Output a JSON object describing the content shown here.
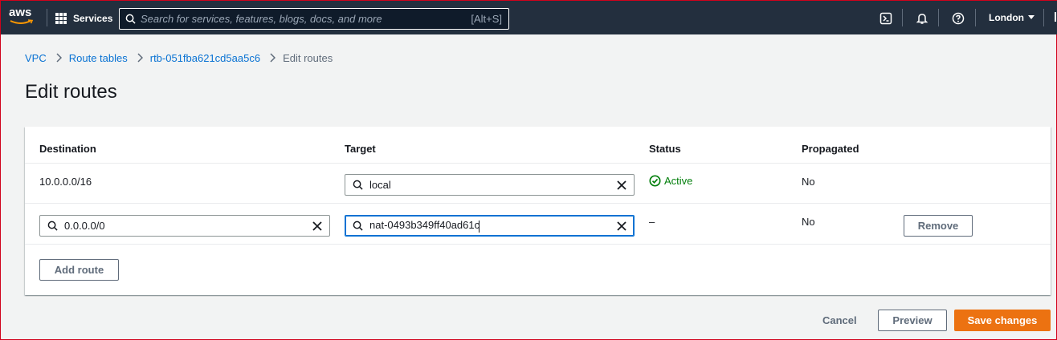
{
  "nav": {
    "logo_text": "aws",
    "services_label": "Services",
    "search_placeholder": "Search for services, features, blogs, docs, and more",
    "search_shortcut": "[Alt+S]",
    "region_label": "London"
  },
  "breadcrumb": {
    "items": [
      "VPC",
      "Route tables",
      "rtb-051fba621cd5aa5c6"
    ],
    "current": "Edit routes"
  },
  "page": {
    "title": "Edit routes"
  },
  "table": {
    "headers": {
      "destination": "Destination",
      "target": "Target",
      "status": "Status",
      "propagated": "Propagated"
    },
    "rows": [
      {
        "destination": "10.0.0.0/16",
        "target": "local",
        "status": "Active",
        "propagated": "No"
      },
      {
        "destination": "0.0.0.0/0",
        "target": "nat-0493b349ff40ad61c",
        "status": "–",
        "propagated": "No",
        "remove_label": "Remove"
      }
    ],
    "add_route_label": "Add route"
  },
  "footer": {
    "cancel_label": "Cancel",
    "preview_label": "Preview",
    "save_label": "Save changes"
  },
  "colors": {
    "nav_bg": "#232f3e",
    "link": "#0972d3",
    "primary": "#ec7211",
    "success": "#037f0c",
    "page_bg": "#f2f3f3"
  },
  "icons": [
    "aws-logo-icon",
    "services-grid-icon",
    "search-icon",
    "cloudshell-icon",
    "notifications-bell-icon",
    "help-icon",
    "caret-down-icon",
    "chevron-right-icon",
    "clear-icon",
    "status-success-icon"
  ]
}
